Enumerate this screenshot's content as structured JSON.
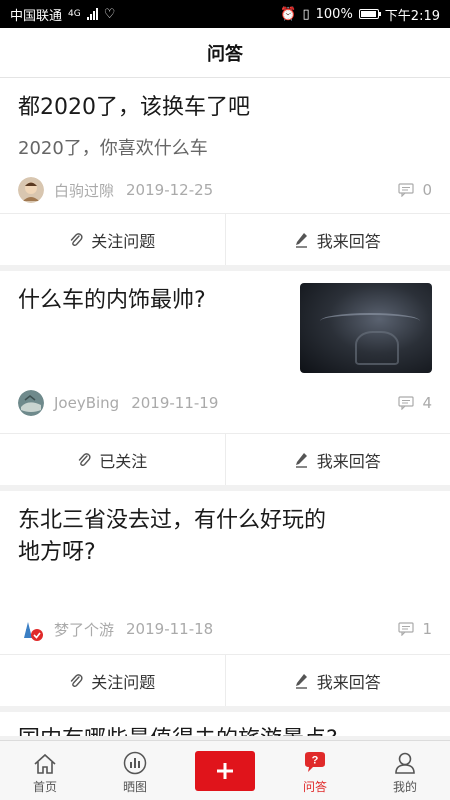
{
  "status_bar": {
    "carrier": "中国联通",
    "network": "4G",
    "battery": "100%",
    "time": "下午2:19"
  },
  "header": {
    "title": "问答"
  },
  "questions": [
    {
      "title": "都2020了，该换车了吧",
      "subtitle": "2020了，你喜欢什么车",
      "author": "白驹过隙",
      "date": "2019-12-25",
      "answer_count": "0",
      "follow_label": "关注问题",
      "answer_label": "我来回答"
    },
    {
      "title": "什么车的内饰最帅?",
      "author": "JoeyBing",
      "date": "2019-11-19",
      "answer_count": "4",
      "follow_label": "已关注",
      "answer_label": "我来回答"
    },
    {
      "title_line1": "东北三省没去过，有什么好玩的",
      "title_line2": "地方呀?",
      "author": "梦了个游",
      "date": "2019-11-18",
      "answer_count": "1",
      "follow_label": "关注问题",
      "answer_label": "我来回答"
    },
    {
      "title": "国内有哪些最值得去的旅游景点?"
    }
  ],
  "bottom_nav": {
    "home": "首页",
    "gallery": "晒图",
    "qa": "问答",
    "qa_badge": "?",
    "mine": "我的"
  },
  "colors": {
    "accent": "#e02a2a",
    "add_button": "#e0141b"
  }
}
